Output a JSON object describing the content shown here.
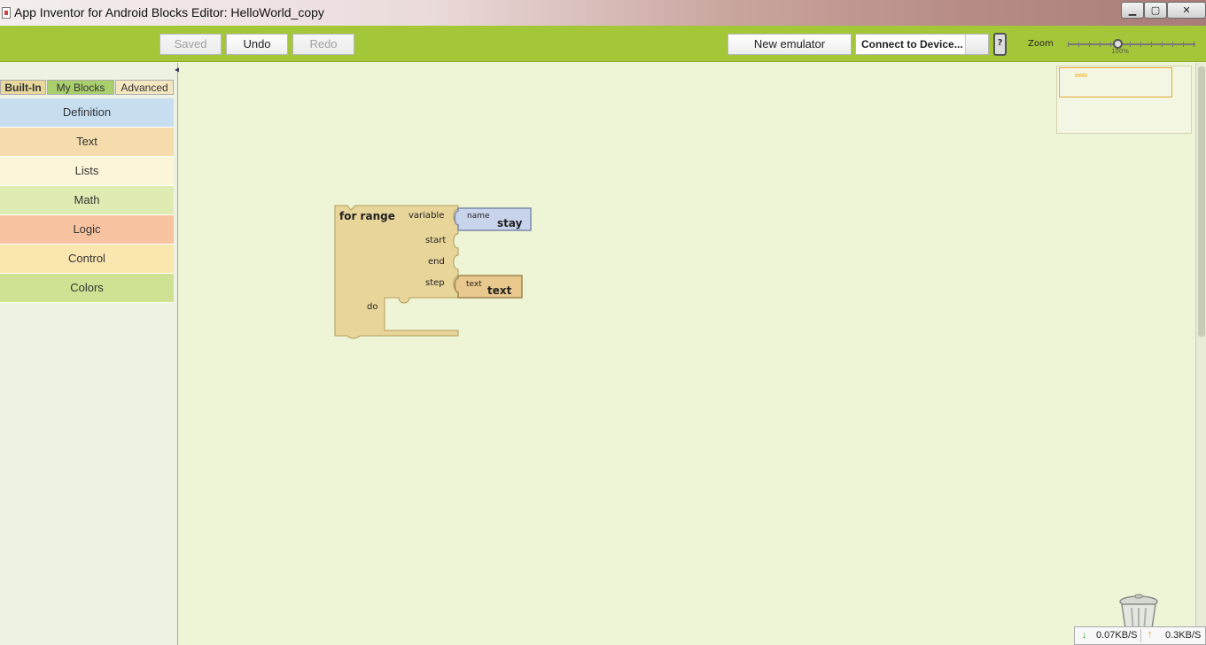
{
  "window": {
    "title": "App Inventor for Android Blocks Editor: HelloWorld_copy",
    "controls": {
      "minimize": "▁",
      "maximize": "▢",
      "close": "✕"
    }
  },
  "toolbar": {
    "saved_label": "Saved",
    "undo_label": "Undo",
    "redo_label": "Redo",
    "new_emulator_label": "New emulator",
    "connect_label": "Connect to Device...",
    "phone_icon_glyph": "?",
    "zoom_label": "Zoom",
    "zoom_value": "100%"
  },
  "drawer": {
    "tabs": [
      "Built-In",
      "My Blocks",
      "Advanced"
    ],
    "active_tab": "Built-In",
    "categories": [
      {
        "label": "Definition",
        "color": "#c7def0"
      },
      {
        "label": "Text",
        "color": "#f5dcad"
      },
      {
        "label": "Lists",
        "color": "#fbf5d9"
      },
      {
        "label": "Math",
        "color": "#deecb4"
      },
      {
        "label": "Logic",
        "color": "#f7c3a1"
      },
      {
        "label": "Control",
        "color": "#fae7b0"
      },
      {
        "label": "Colors",
        "color": "#cfe193"
      }
    ]
  },
  "workspace": {
    "for_range_block": {
      "title": "for range",
      "sockets": [
        "variable",
        "start",
        "end",
        "step"
      ],
      "do_label": "do",
      "color": "#e8d59a"
    },
    "name_block": {
      "label": "name",
      "value": "stay",
      "color": "#c8d4ec"
    },
    "text_block": {
      "label": "text",
      "value": "text",
      "color": "#e8c88c"
    }
  },
  "status": {
    "download": "0.07KB/S",
    "upload": "0.3KB/S"
  }
}
